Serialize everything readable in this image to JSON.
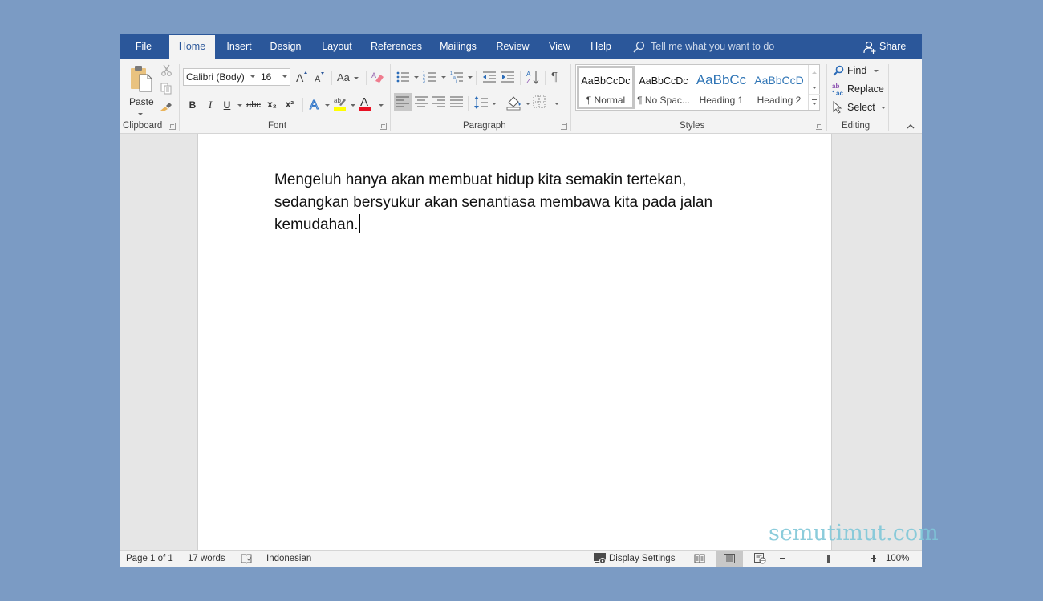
{
  "tabs": [
    {
      "label": "File",
      "active": false
    },
    {
      "label": "Home",
      "active": true
    },
    {
      "label": "Insert",
      "active": false
    },
    {
      "label": "Design",
      "active": false
    },
    {
      "label": "Layout",
      "active": false
    },
    {
      "label": "References",
      "active": false
    },
    {
      "label": "Mailings",
      "active": false
    },
    {
      "label": "Review",
      "active": false
    },
    {
      "label": "View",
      "active": false
    },
    {
      "label": "Help",
      "active": false
    }
  ],
  "tell_me": {
    "placeholder": "Tell me what you want to do",
    "icon": "search-icon"
  },
  "share": {
    "label": "Share",
    "icon": "person-add-icon"
  },
  "ribbon": {
    "clipboard": {
      "label": "Clipboard",
      "paste_label": "Paste",
      "icons": [
        "paste-icon",
        "cut-icon",
        "copy-icon",
        "format-painter-icon"
      ]
    },
    "font": {
      "label": "Font",
      "font_name": "Calibri (Body)",
      "font_size": "16",
      "case_label": "Aa",
      "buttons": {
        "bold": "B",
        "italic": "I",
        "underline": "U",
        "strikethrough": "abc",
        "subscript": "x₂",
        "superscript": "x²"
      },
      "highlight_color": "#ffff00",
      "font_color": "#e81123"
    },
    "paragraph": {
      "label": "Paragraph",
      "active_alignment": "left"
    },
    "styles": {
      "label": "Styles",
      "items": [
        {
          "preview": "AaBbCcDc",
          "name": "¶ Normal",
          "selected": true
        },
        {
          "preview": "AaBbCcDc",
          "name": "¶ No Spac...",
          "selected": false
        },
        {
          "preview": "AaBbCc",
          "name": "Heading 1",
          "selected": false
        },
        {
          "preview": "AaBbCcD",
          "name": "Heading 2",
          "selected": false
        }
      ]
    },
    "editing": {
      "label": "Editing",
      "find": "Find",
      "replace": "Replace",
      "select": "Select"
    }
  },
  "document": {
    "text": "Mengeluh hanya akan membuat hidup kita semakin tertekan, sedangkan bersyukur akan senantiasa membawa kita pada jalan kemudahan."
  },
  "watermark": "semutimut.com",
  "status": {
    "page": "Page 1 of 1",
    "words": "17 words",
    "language": "Indonesian",
    "display_settings": "Display Settings",
    "zoom": "100%",
    "zoom_value_percent": 100,
    "active_view": "print-layout"
  }
}
